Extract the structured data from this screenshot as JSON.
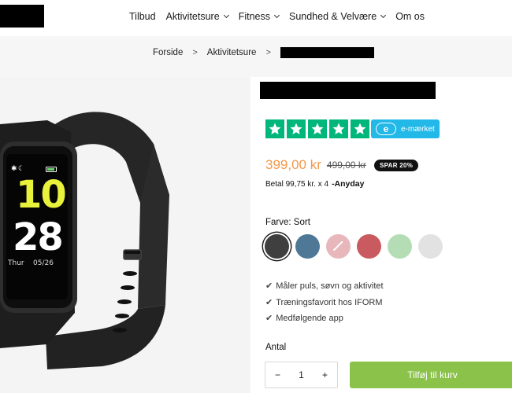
{
  "header": {
    "nav": [
      {
        "label": "Tilbud",
        "dropdown": false
      },
      {
        "label": "Aktivitetsure",
        "dropdown": true
      },
      {
        "label": "Fitness",
        "dropdown": true
      },
      {
        "label": "Sundhed & Velvære",
        "dropdown": true
      },
      {
        "label": "Om os",
        "dropdown": false
      }
    ]
  },
  "breadcrumb": {
    "items": [
      "Forside",
      "Aktivitetsure"
    ],
    "separator": ">"
  },
  "product_image": {
    "time_hour": "10",
    "time_minute": "28",
    "day": "Thur",
    "date": "05/26"
  },
  "rating": {
    "stars": 5,
    "emark_label": "e-mærket",
    "emark_logo": "e"
  },
  "price": {
    "current": "399,00 kr",
    "original": "499,00 kr",
    "save_badge": "SPAR 20%"
  },
  "installment": {
    "text": "Betal 99,75 kr. x 4",
    "provider": "-Anyday"
  },
  "color": {
    "label": "Farve:",
    "selected": "Sort",
    "swatches": [
      "#3f3f3f",
      "#4f7896",
      "#e8b7bb",
      "#c95a5f",
      "#b4ddb6",
      "#e2e2e2"
    ]
  },
  "features": [
    "Måler puls, søvn og aktivitet",
    "Træningsfavorit hos IFORM",
    "Medfølgende app"
  ],
  "quantity": {
    "label": "Antal",
    "value": "1",
    "minus": "−",
    "plus": "+"
  },
  "cta": {
    "label": "Tilføj til kurv"
  },
  "colors": {
    "accent_green": "#8bc34a",
    "price_orange": "#f2994a",
    "trustpilot_green": "#00b67a",
    "emark_blue": "#22b8e8"
  }
}
